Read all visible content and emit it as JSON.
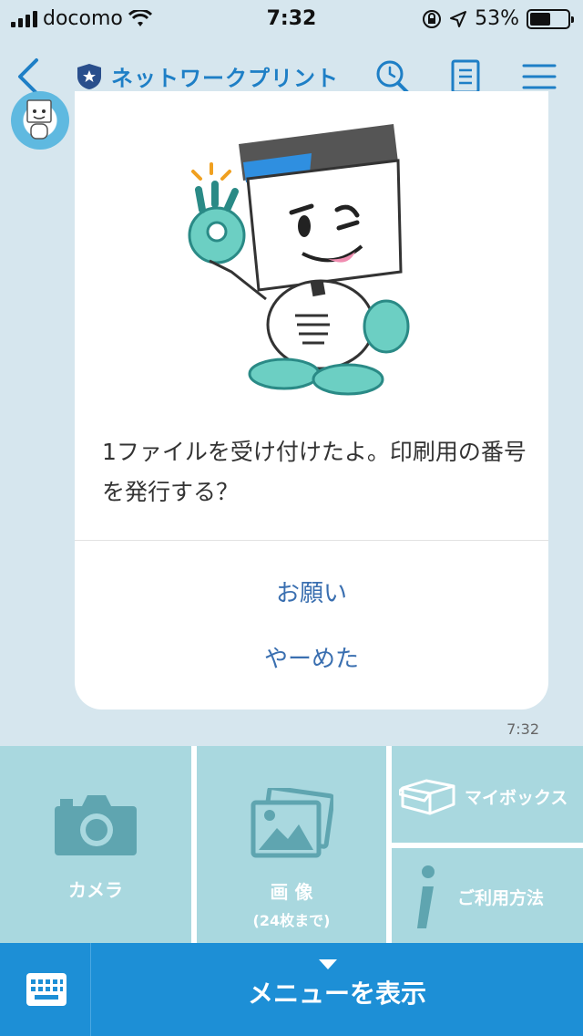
{
  "status_bar": {
    "carrier": "docomo",
    "time": "7:32",
    "battery": "53%",
    "battery_level": 0.53
  },
  "nav": {
    "title": "ネットワークプリント",
    "colors": {
      "accent": "#1e7fc6"
    }
  },
  "chat": {
    "message": "1ファイルを受け付けたよ。印刷用の番号を発行する？",
    "actions": [
      "お願い",
      "やーめた"
    ],
    "timestamp": "7:32"
  },
  "rich_menu": {
    "camera": "カメラ",
    "image_title": "画 像",
    "image_sub": "(24枚まで)",
    "mybox": "マイボックス",
    "howto": "ご利用方法"
  },
  "bottom_bar": {
    "menu_toggle": "メニューを表示",
    "colors": {
      "bar": "#1d8fd6"
    }
  }
}
